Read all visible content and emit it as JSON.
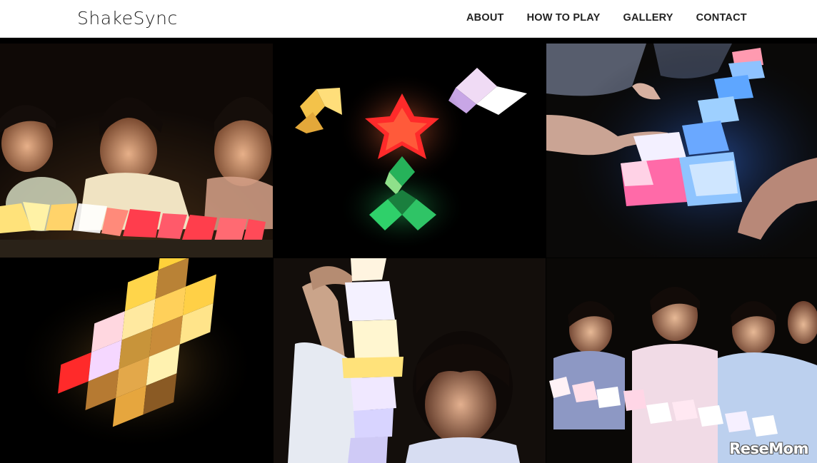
{
  "site": {
    "logo": "ShakeSync"
  },
  "nav": {
    "items": [
      {
        "label": "ABOUT"
      },
      {
        "label": "HOW TO PLAY"
      },
      {
        "label": "GALLERY"
      },
      {
        "label": "CONTACT"
      }
    ]
  },
  "colors": {
    "navbar_bg": "#ffffff",
    "text": "#222222",
    "gallery_bg": "#000000"
  },
  "gallery": {
    "photos": [
      {
        "subject": "children-with-glowing-tile-row"
      },
      {
        "subject": "glowing-star-flower-arrangement"
      },
      {
        "subject": "hands-touching-blue-tile-chain"
      },
      {
        "subject": "glowing-diamond-tile-grid"
      },
      {
        "subject": "child-stacking-glowing-tiles"
      },
      {
        "subject": "children-holding-glowing-tiles"
      }
    ]
  },
  "watermark": {
    "text": "ReseMom"
  }
}
